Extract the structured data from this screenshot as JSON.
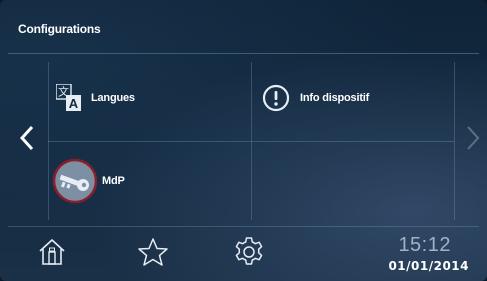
{
  "header": {
    "title": "Configurations"
  },
  "menu": {
    "items": [
      {
        "label": "Langues",
        "icon": "translate-icon"
      },
      {
        "label": "Info dispositif",
        "icon": "info-icon"
      },
      {
        "label": "MdP",
        "icon": "key-icon"
      }
    ]
  },
  "nav": {
    "prev_icon": "chevron-left-icon",
    "next_icon": "chevron-right-icon",
    "next_enabled": false
  },
  "footer": {
    "home_icon": "home-icon",
    "favorites_icon": "star-icon",
    "settings_icon": "gear-icon",
    "time": "15:12",
    "date": "01/01/2014"
  },
  "colors": {
    "key_ring": "#8a1e2a",
    "key_fill": "#7d8fa3",
    "icon_stroke": "#e6edf5",
    "dim": "#5d6f84"
  }
}
